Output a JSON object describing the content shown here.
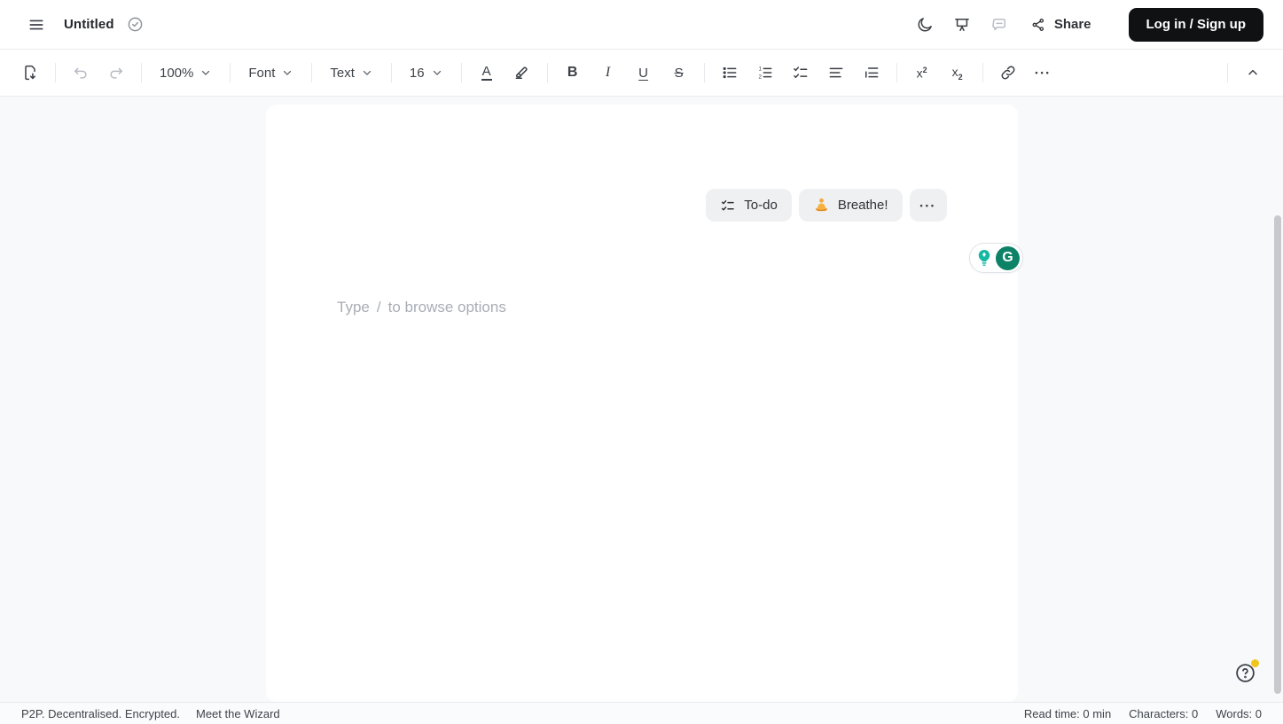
{
  "header": {
    "title": "Untitled",
    "share_label": "Share",
    "login_label": "Log in / Sign up"
  },
  "toolbar": {
    "zoom_level": "100%",
    "font_family_label": "Font",
    "paragraph_style_label": "Text",
    "font_size": "16",
    "glyphs": {
      "text_color": "A",
      "bold": "B",
      "italic": "I",
      "underline": "U",
      "strikethrough": "S",
      "script_base": "x",
      "script_number": "2",
      "more": "•••"
    }
  },
  "editor": {
    "placeholder": {
      "prefix": "Type",
      "slash": "/",
      "suffix": "to browse options"
    },
    "quick_actions": {
      "todo_label": "To-do",
      "breathe_label": "Breathe!",
      "breathe_emoji": "🧘",
      "more_glyph": "•••"
    }
  },
  "grammarly": {
    "g_letter": "G"
  },
  "status_bar": {
    "tagline": "P2P. Decentralised. Encrypted.",
    "wizard_link": "Meet the Wizard",
    "read_time": "Read time: 0 min",
    "characters": "Characters: 0",
    "words": "Words: 0"
  },
  "colors": {
    "login_button_bg": "#101113",
    "grammarly_green": "#0d8266",
    "lightbulb_teal": "#16b8a2",
    "notification_dot": "#f2c51c"
  }
}
